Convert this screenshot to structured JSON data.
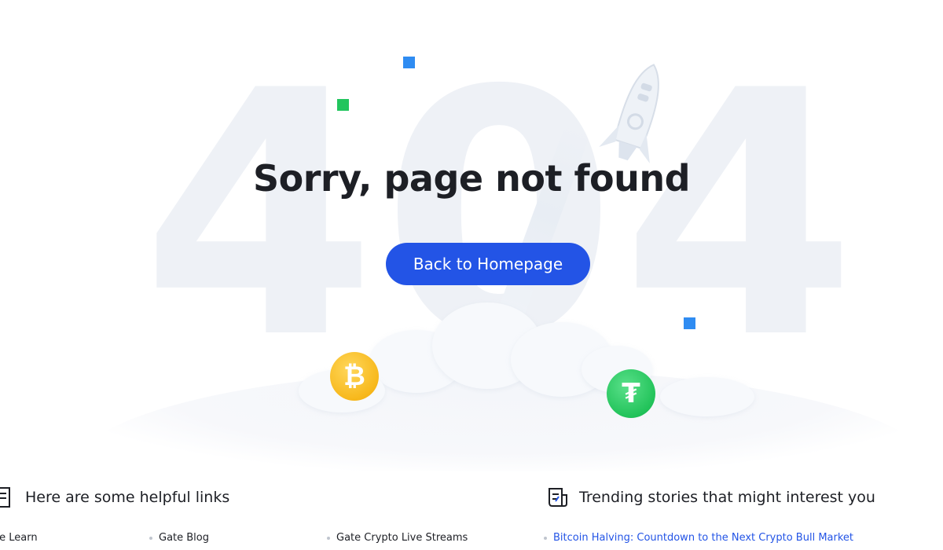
{
  "background": {
    "big_number": [
      "4",
      "0",
      "4"
    ]
  },
  "hero": {
    "headline": "Sorry, page not found",
    "button_label": "Back to Homepage"
  },
  "coins": {
    "bitcoin_symbol": "₿",
    "tether_symbol": "₮"
  },
  "helpful_links": {
    "heading": "Here are some helpful links",
    "items": [
      "te Learn",
      "Gate Blog",
      "Gate Crypto Live Streams"
    ]
  },
  "trending": {
    "heading": "Trending stories that might interest you",
    "items": [
      "Bitcoin Halving: Countdown to the Next Crypto Bull Market"
    ]
  },
  "colors": {
    "accent": "#2354e6",
    "background_number": "#eef1f6",
    "square_blue": "#2f8cf2",
    "square_green": "#22c55e",
    "bitcoin": "#f7b81c",
    "tether": "#22c35a"
  },
  "icons": [
    "bitcoin-coin-icon",
    "tether-coin-icon",
    "rocket-icon",
    "link-list-icon",
    "news-icon"
  ]
}
